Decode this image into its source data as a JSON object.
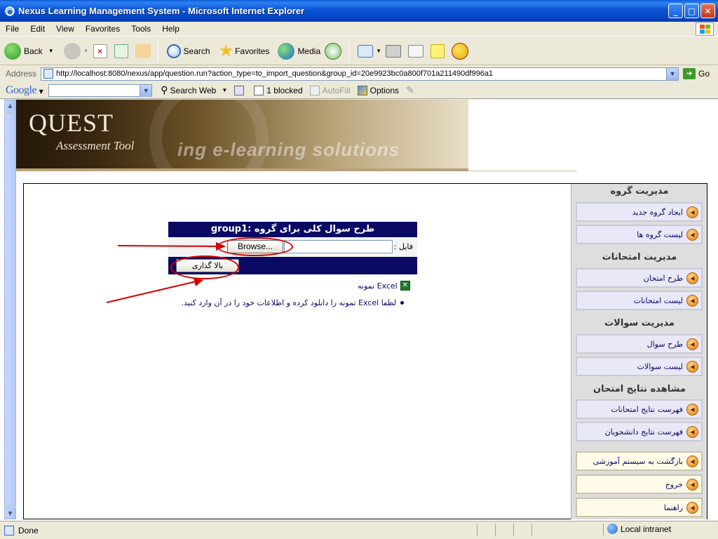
{
  "window": {
    "title": "Nexus Learning Management System - Microsoft Internet Explorer",
    "min_label": "_",
    "max_label": "□",
    "close_label": "✕"
  },
  "menubar": [
    "File",
    "Edit",
    "View",
    "Favorites",
    "Tools",
    "Help"
  ],
  "toolbar": {
    "back": "Back",
    "search": "Search",
    "favorites": "Favorites",
    "media": "Media"
  },
  "address": {
    "label": "Address",
    "url": "http://localhost:8080/nexus/app/question.run?action_type=to_import_question&group_id=20e9923bc0a800f701a211490df996a1",
    "go": "Go"
  },
  "googlebar": {
    "logo": "Google",
    "search_web": "Search Web",
    "blocked": "1 blocked",
    "autofill": "AutoFill",
    "options": "Options"
  },
  "banner": {
    "title": "QUEST",
    "subtitle": "Assessment Tool",
    "tagline": "ing e-learning solutions"
  },
  "form": {
    "header": "طرح سوال کلی برای گروه :group1",
    "file_label": "فایل :",
    "browse": "Browse...",
    "upload": "بالا گذاری",
    "excel_link": "Excel نمونه",
    "instruction": "لطفا Excel نمونه را دانلود کرده و اطلاعات خود را در آن وارد کنید."
  },
  "sidebar": {
    "sections": [
      {
        "title": "مدیریت گروه",
        "items": [
          "ایجاد گروه جدید",
          "لیست گروه ها"
        ]
      },
      {
        "title": "مدیریت امتحانات",
        "items": [
          "طرح امتحان",
          "لیست امتحانات"
        ]
      },
      {
        "title": "مدیریت سوالات",
        "items": [
          "طرح سوال",
          "لیست سوالات"
        ]
      },
      {
        "title": "مشاهده نتایج امتحان",
        "items": [
          "فهرست نتایج امتحانات",
          "فهرست نتایج دانشجویان"
        ]
      }
    ],
    "bottom_items": [
      "بازگشت به سیستم آموزشی",
      "خروج",
      "راهنما"
    ]
  },
  "status": {
    "text": "Done",
    "zone": "Local intranet"
  },
  "colors": {
    "form_header_bg": "#0a0a64",
    "annotation_red": "#d40000",
    "menu_arrow": "#f1a03a"
  }
}
